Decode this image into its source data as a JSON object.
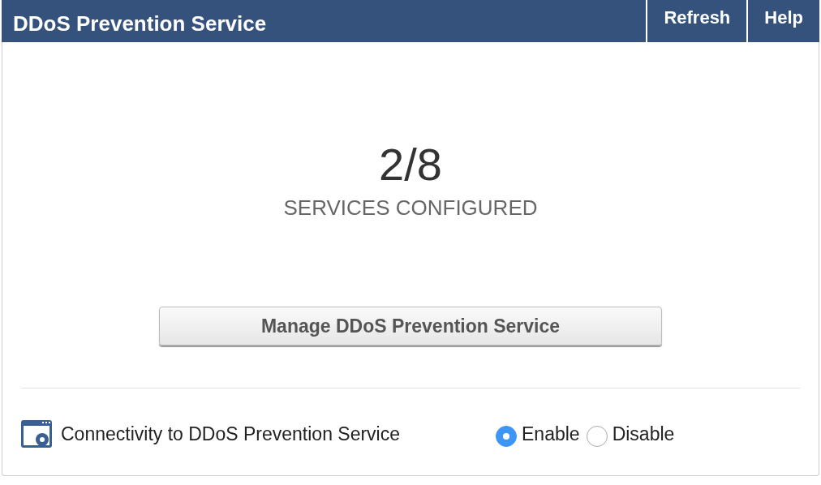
{
  "header": {
    "title": "DDoS Prevention Service",
    "buttons": [
      "Refresh",
      "Help"
    ]
  },
  "summary": {
    "count": "2/8",
    "caption": "SERVICES CONFIGURED"
  },
  "manage_button": "Manage DDoS Prevention Service",
  "connectivity": {
    "label": "Connectivity to DDoS Prevention Service",
    "options": [
      {
        "label": "Enable",
        "selected": true
      },
      {
        "label": "Disable",
        "selected": false
      }
    ]
  }
}
